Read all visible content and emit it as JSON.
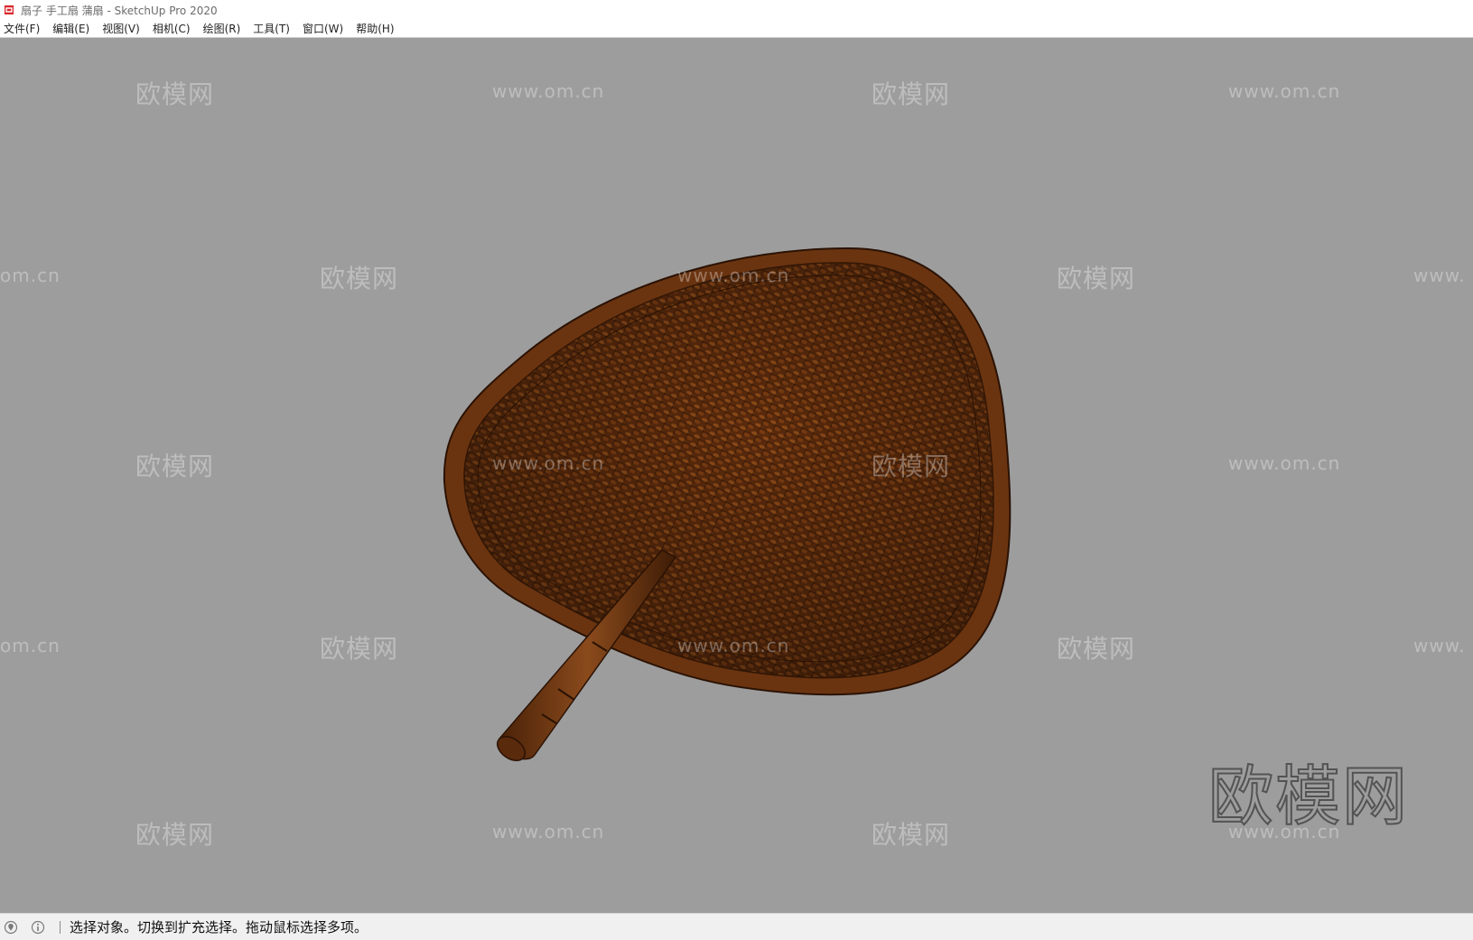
{
  "window": {
    "title": "扇子 手工扇 蒲扇 - SketchUp Pro 2020",
    "icon": "sketchup-logo-icon"
  },
  "menu": {
    "items": [
      {
        "label": "文件(F)"
      },
      {
        "label": "编辑(E)"
      },
      {
        "label": "视图(V)"
      },
      {
        "label": "相机(C)"
      },
      {
        "label": "绘图(R)"
      },
      {
        "label": "工具(T)"
      },
      {
        "label": "窗口(W)"
      },
      {
        "label": "帮助(H)"
      }
    ]
  },
  "watermarks": {
    "brand": "欧模网",
    "url": "www.om.cn",
    "url_partial_left": "om.cn",
    "url_partial_right": "www."
  },
  "statusbar": {
    "icons": [
      "geo-location-icon",
      "info-icon"
    ],
    "message": "选择对象。切换到扩充选择。拖动鼠标选择多项。"
  },
  "colors": {
    "viewport_bg": "#9d9d9d",
    "fan_brown": "#6b3410",
    "fan_rim": "#8a4a1c"
  }
}
